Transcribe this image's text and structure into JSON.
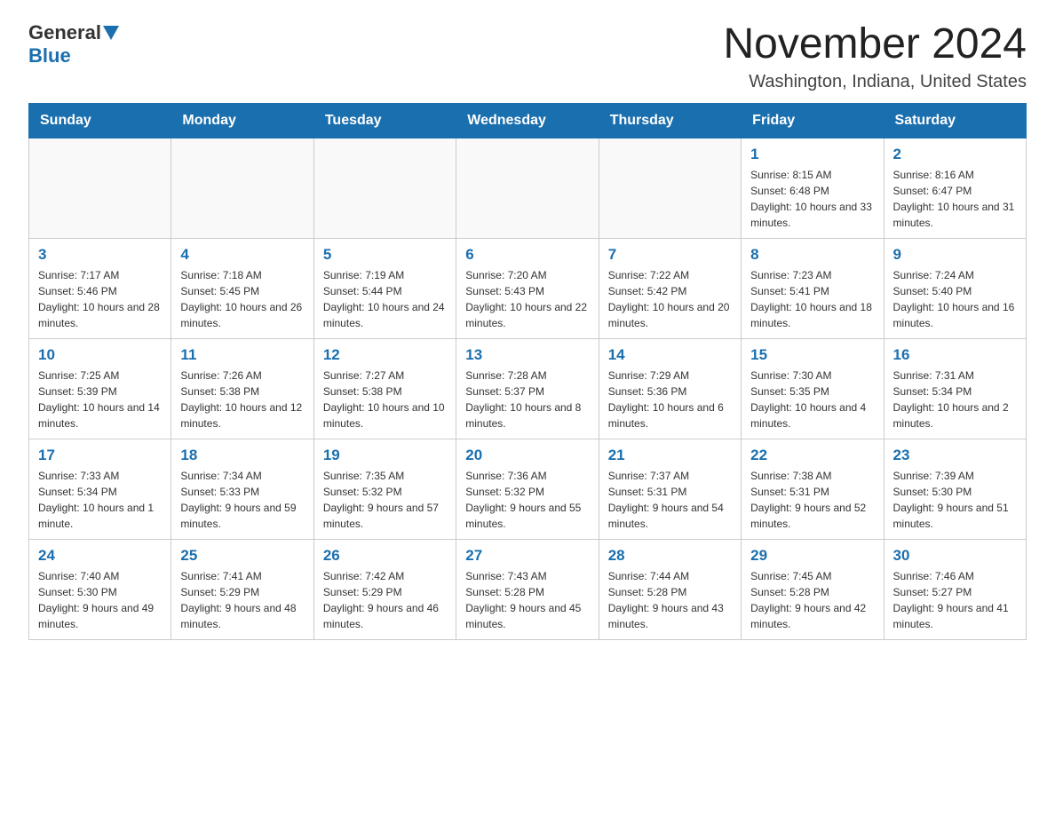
{
  "logo": {
    "general": "General",
    "blue": "Blue"
  },
  "title": "November 2024",
  "location": "Washington, Indiana, United States",
  "days_of_week": [
    "Sunday",
    "Monday",
    "Tuesday",
    "Wednesday",
    "Thursday",
    "Friday",
    "Saturday"
  ],
  "weeks": [
    [
      {
        "day": "",
        "info": ""
      },
      {
        "day": "",
        "info": ""
      },
      {
        "day": "",
        "info": ""
      },
      {
        "day": "",
        "info": ""
      },
      {
        "day": "",
        "info": ""
      },
      {
        "day": "1",
        "info": "Sunrise: 8:15 AM\nSunset: 6:48 PM\nDaylight: 10 hours and 33 minutes."
      },
      {
        "day": "2",
        "info": "Sunrise: 8:16 AM\nSunset: 6:47 PM\nDaylight: 10 hours and 31 minutes."
      }
    ],
    [
      {
        "day": "3",
        "info": "Sunrise: 7:17 AM\nSunset: 5:46 PM\nDaylight: 10 hours and 28 minutes."
      },
      {
        "day": "4",
        "info": "Sunrise: 7:18 AM\nSunset: 5:45 PM\nDaylight: 10 hours and 26 minutes."
      },
      {
        "day": "5",
        "info": "Sunrise: 7:19 AM\nSunset: 5:44 PM\nDaylight: 10 hours and 24 minutes."
      },
      {
        "day": "6",
        "info": "Sunrise: 7:20 AM\nSunset: 5:43 PM\nDaylight: 10 hours and 22 minutes."
      },
      {
        "day": "7",
        "info": "Sunrise: 7:22 AM\nSunset: 5:42 PM\nDaylight: 10 hours and 20 minutes."
      },
      {
        "day": "8",
        "info": "Sunrise: 7:23 AM\nSunset: 5:41 PM\nDaylight: 10 hours and 18 minutes."
      },
      {
        "day": "9",
        "info": "Sunrise: 7:24 AM\nSunset: 5:40 PM\nDaylight: 10 hours and 16 minutes."
      }
    ],
    [
      {
        "day": "10",
        "info": "Sunrise: 7:25 AM\nSunset: 5:39 PM\nDaylight: 10 hours and 14 minutes."
      },
      {
        "day": "11",
        "info": "Sunrise: 7:26 AM\nSunset: 5:38 PM\nDaylight: 10 hours and 12 minutes."
      },
      {
        "day": "12",
        "info": "Sunrise: 7:27 AM\nSunset: 5:38 PM\nDaylight: 10 hours and 10 minutes."
      },
      {
        "day": "13",
        "info": "Sunrise: 7:28 AM\nSunset: 5:37 PM\nDaylight: 10 hours and 8 minutes."
      },
      {
        "day": "14",
        "info": "Sunrise: 7:29 AM\nSunset: 5:36 PM\nDaylight: 10 hours and 6 minutes."
      },
      {
        "day": "15",
        "info": "Sunrise: 7:30 AM\nSunset: 5:35 PM\nDaylight: 10 hours and 4 minutes."
      },
      {
        "day": "16",
        "info": "Sunrise: 7:31 AM\nSunset: 5:34 PM\nDaylight: 10 hours and 2 minutes."
      }
    ],
    [
      {
        "day": "17",
        "info": "Sunrise: 7:33 AM\nSunset: 5:34 PM\nDaylight: 10 hours and 1 minute."
      },
      {
        "day": "18",
        "info": "Sunrise: 7:34 AM\nSunset: 5:33 PM\nDaylight: 9 hours and 59 minutes."
      },
      {
        "day": "19",
        "info": "Sunrise: 7:35 AM\nSunset: 5:32 PM\nDaylight: 9 hours and 57 minutes."
      },
      {
        "day": "20",
        "info": "Sunrise: 7:36 AM\nSunset: 5:32 PM\nDaylight: 9 hours and 55 minutes."
      },
      {
        "day": "21",
        "info": "Sunrise: 7:37 AM\nSunset: 5:31 PM\nDaylight: 9 hours and 54 minutes."
      },
      {
        "day": "22",
        "info": "Sunrise: 7:38 AM\nSunset: 5:31 PM\nDaylight: 9 hours and 52 minutes."
      },
      {
        "day": "23",
        "info": "Sunrise: 7:39 AM\nSunset: 5:30 PM\nDaylight: 9 hours and 51 minutes."
      }
    ],
    [
      {
        "day": "24",
        "info": "Sunrise: 7:40 AM\nSunset: 5:30 PM\nDaylight: 9 hours and 49 minutes."
      },
      {
        "day": "25",
        "info": "Sunrise: 7:41 AM\nSunset: 5:29 PM\nDaylight: 9 hours and 48 minutes."
      },
      {
        "day": "26",
        "info": "Sunrise: 7:42 AM\nSunset: 5:29 PM\nDaylight: 9 hours and 46 minutes."
      },
      {
        "day": "27",
        "info": "Sunrise: 7:43 AM\nSunset: 5:28 PM\nDaylight: 9 hours and 45 minutes."
      },
      {
        "day": "28",
        "info": "Sunrise: 7:44 AM\nSunset: 5:28 PM\nDaylight: 9 hours and 43 minutes."
      },
      {
        "day": "29",
        "info": "Sunrise: 7:45 AM\nSunset: 5:28 PM\nDaylight: 9 hours and 42 minutes."
      },
      {
        "day": "30",
        "info": "Sunrise: 7:46 AM\nSunset: 5:27 PM\nDaylight: 9 hours and 41 minutes."
      }
    ]
  ]
}
